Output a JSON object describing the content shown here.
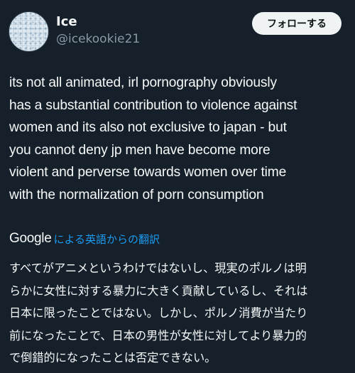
{
  "colors": {
    "background": "#15202b",
    "text_primary": "#f7f9f9",
    "text_secondary": "#8b98a5",
    "link_blue": "#1d9bf0",
    "button_bg": "#eff3f4",
    "button_text": "#0f1419"
  },
  "user": {
    "display_name": "Ice",
    "handle": "@icekookie21"
  },
  "follow_button": {
    "label": "フォローする"
  },
  "tweet": {
    "lines": [
      "its not all animated, irl pornography obviously",
      "has a substantial contribution to violence against",
      "women and its also not exclusive to japan - but",
      "you cannot deny jp men have become more",
      "violent and perverse towards women over time",
      "with the normalization of porn consumption"
    ]
  },
  "translation": {
    "provider": "Google",
    "link_text": "による英語からの翻訳",
    "lines": [
      "すべてがアニメというわけではないし、現実のポルノは明",
      "らかに女性に対する暴力に大きく貢献しているし、それは",
      "日本に限ったことではない。しかし、ポルノ消費が当たり",
      "前になったことで、日本の男性が女性に対してより暴力的",
      "で倒錯的になったことは否定できない。"
    ]
  }
}
